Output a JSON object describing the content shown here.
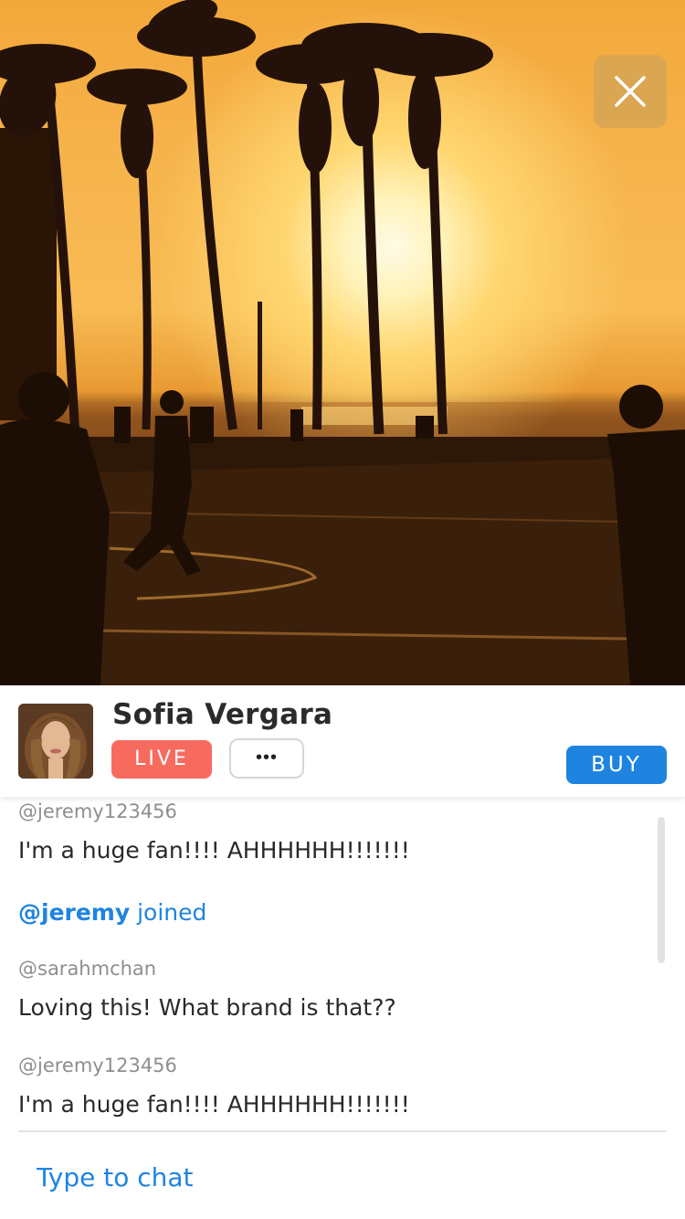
{
  "stream": {
    "host_name": "Sofia Vergara",
    "live_label": "LIVE",
    "more_label": "•••",
    "buy_label": "BUY"
  },
  "chat": {
    "messages": [
      {
        "user": "@jeremy123456",
        "text": "I'm a huge fan!!!! AHHHHHH!!!!!!!"
      },
      {
        "join_handle": "@jeremy",
        "join_text": "joined"
      },
      {
        "user": "@sarahmchan",
        "text": "Loving this! What brand is that??"
      },
      {
        "user": "@jeremy123456",
        "text": "I'm a huge fan!!!! AHHHHHH!!!!!!!"
      }
    ],
    "input_placeholder": "Type to chat"
  },
  "colors": {
    "live_badge": "#f76b5f",
    "buy_button": "#1e84e0",
    "accent_text": "#1e84e0"
  },
  "icons": {
    "close": "close-icon",
    "more": "more-dots-icon"
  }
}
